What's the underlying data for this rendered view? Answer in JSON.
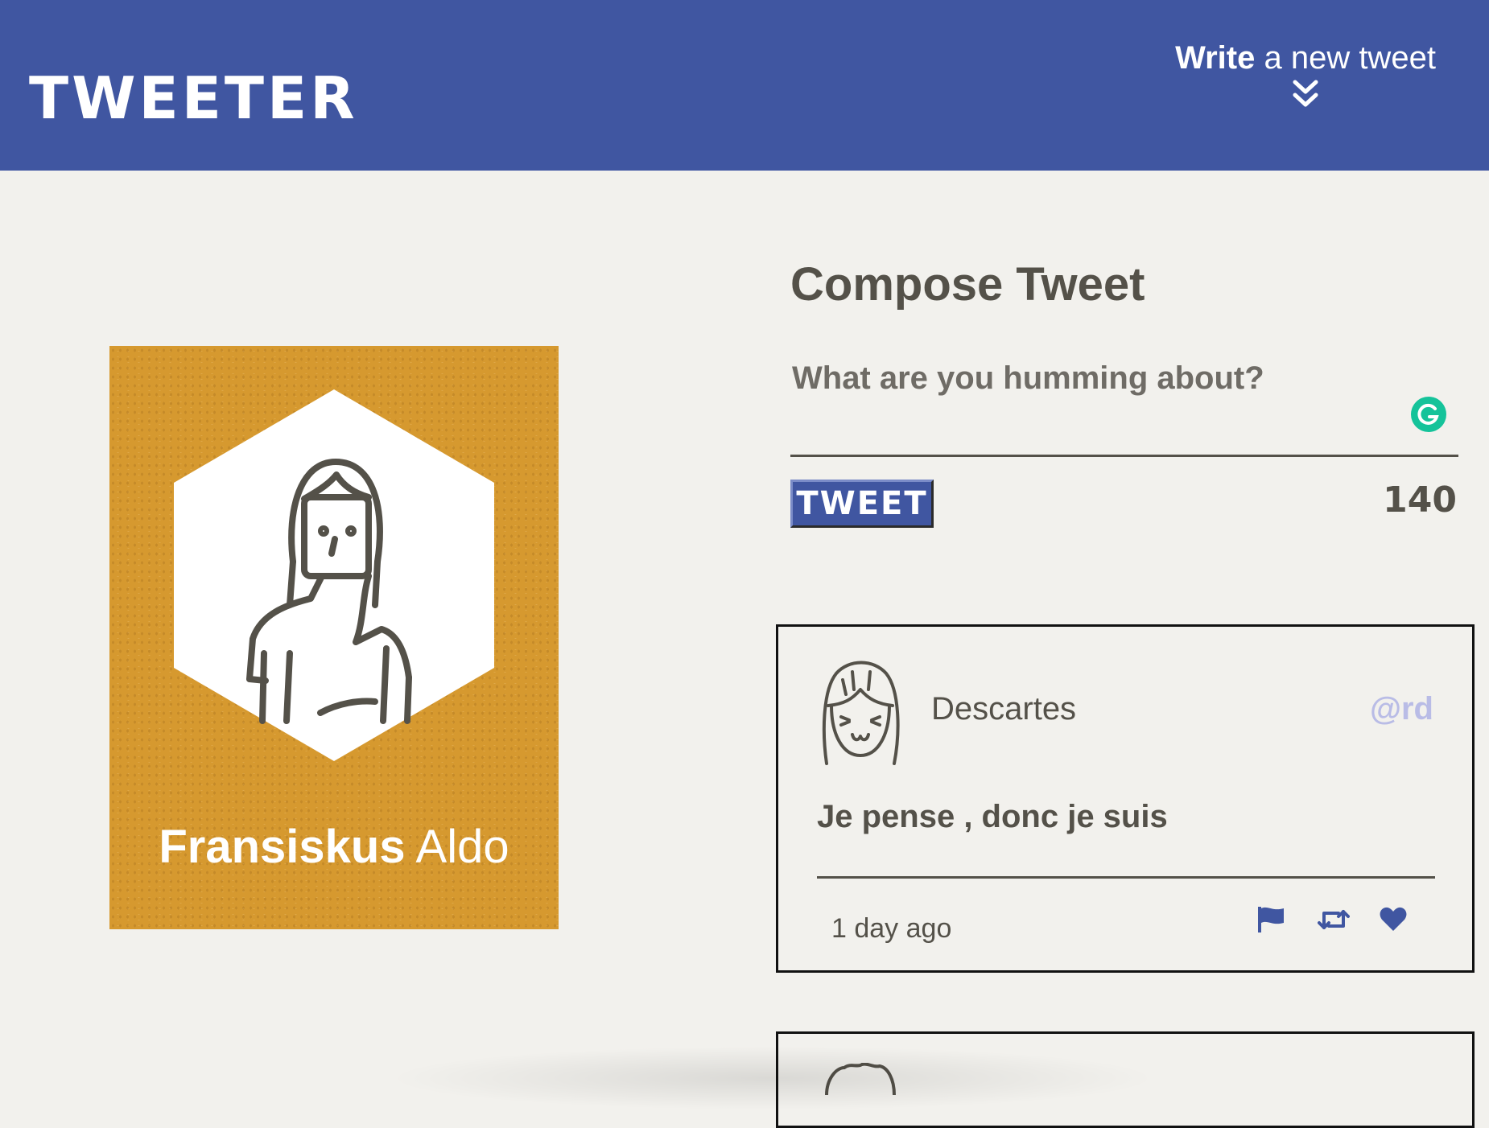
{
  "nav": {
    "brand": "TWEETER",
    "toggle_strong": "Write",
    "toggle_rest": "a new tweet",
    "toggle_icon": "double-chevron-down-icon"
  },
  "profile": {
    "first_name": "Fransiskus",
    "last_name": "Aldo",
    "background": "#d6992f"
  },
  "compose": {
    "title": "Compose Tweet",
    "placeholder": "What are you humming about?",
    "button_label": "TWEET",
    "counter": "140"
  },
  "tweets": [
    {
      "name": "Descartes",
      "handle": "@rd",
      "content": "Je pense , donc je suis",
      "time": "1 day ago",
      "actions": [
        "flag-icon",
        "retweet-icon",
        "heart-icon"
      ]
    }
  ],
  "colors": {
    "nav": "#4056a1",
    "background": "#f2f1ed",
    "text": "#545149",
    "handle": "#b9bce6",
    "grammarly": "#15c39a"
  }
}
